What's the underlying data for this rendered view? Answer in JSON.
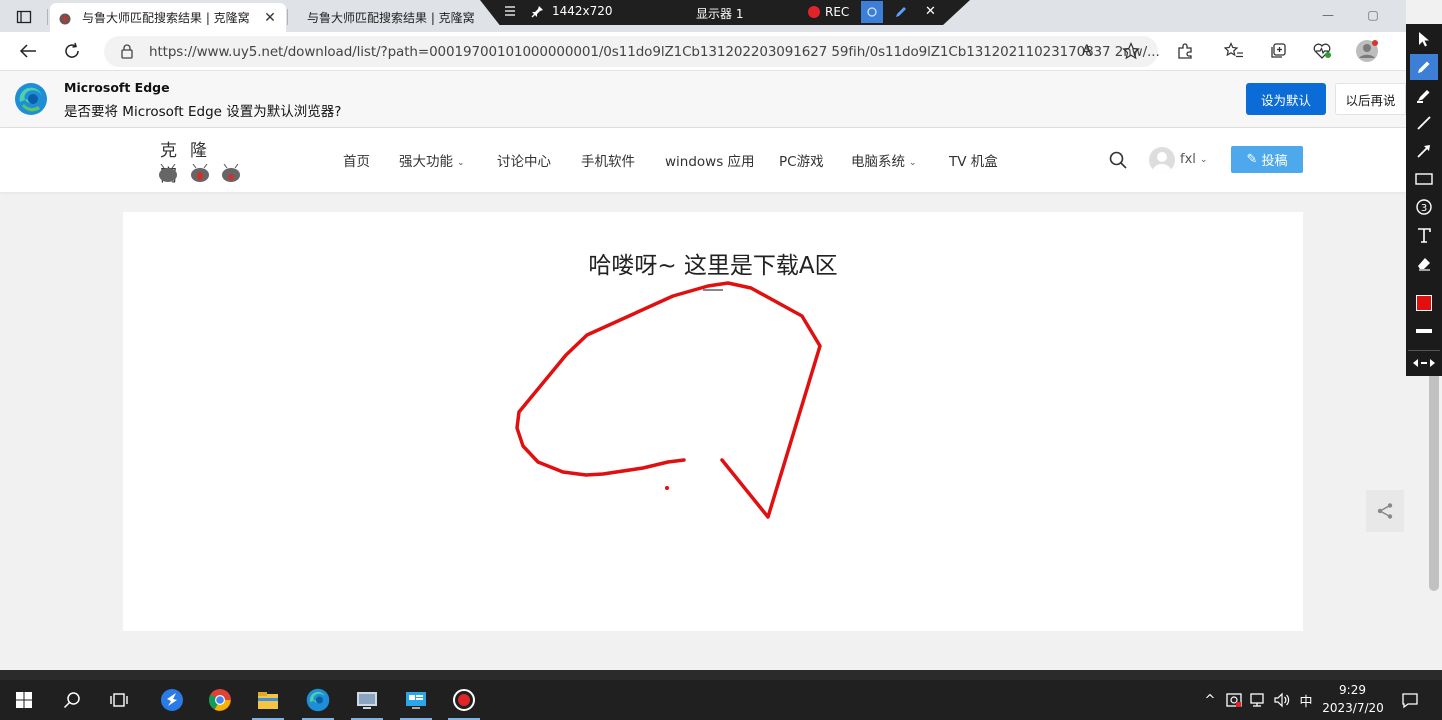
{
  "browser": {
    "tabs": [
      {
        "title": "与鲁大师匹配搜索结果 | 克隆窝",
        "active": true
      },
      {
        "title": "与鲁大师匹配搜索结果 | 克隆窝",
        "active": false
      }
    ],
    "tab_close_glyph": "✕",
    "address": "https://www.uy5.net/download/list/?path=00019700101000000001/0s11do9lZ1Cb131202203091627 59fih/0s11do9lZ1Cb13120211023170837 2nw/...",
    "read_aloud_label": "A",
    "window_controls": {
      "minimize": "—",
      "maximize": "▢",
      "close": "✕"
    }
  },
  "recorder": {
    "resolution": "1442x720",
    "display": "显示器 1",
    "rec_label": "REC",
    "close_glyph": "✕"
  },
  "infobar": {
    "title": "Microsoft Edge",
    "message": "是否要将 Microsoft Edge 设置为默认浏览器?",
    "primary_button": "设为默认",
    "secondary_button": "以后再说"
  },
  "site": {
    "logo_text": "克隆窝",
    "nav": [
      {
        "label": "首页",
        "has_dropdown": false
      },
      {
        "label": "强大功能",
        "has_dropdown": true
      },
      {
        "label": "讨论中心",
        "has_dropdown": false
      },
      {
        "label": "手机软件",
        "has_dropdown": false
      },
      {
        "label": "windows 应用",
        "has_dropdown": false
      },
      {
        "label": "PC游戏",
        "has_dropdown": false
      },
      {
        "label": "电脑系统",
        "has_dropdown": true
      },
      {
        "label": "TV 机盒",
        "has_dropdown": false
      }
    ],
    "dropdown_glyph": "⌄",
    "username": "fxl",
    "post_button": "投稿",
    "post_icon": "✎"
  },
  "content": {
    "title": "哈喽呀~ 这里是下载A区"
  },
  "annotation": {
    "active_tool": "pen",
    "pen_color": "#e01010"
  },
  "taskbar": {
    "time": "9:29",
    "date": "2023/7/20",
    "ime": "中",
    "chevron": "^",
    "apps": [
      "start-icon",
      "search-icon",
      "task-view-icon",
      "feishu-icon",
      "chrome-icon",
      "file-explorer-icon",
      "edge-icon",
      "screenshot-tool-icon",
      "remote-desktop-icon",
      "recorder-icon"
    ]
  },
  "colors": {
    "accent_blue": "#0b6cd7",
    "post_blue": "#4ea8ec",
    "ink_red": "#e01010"
  }
}
